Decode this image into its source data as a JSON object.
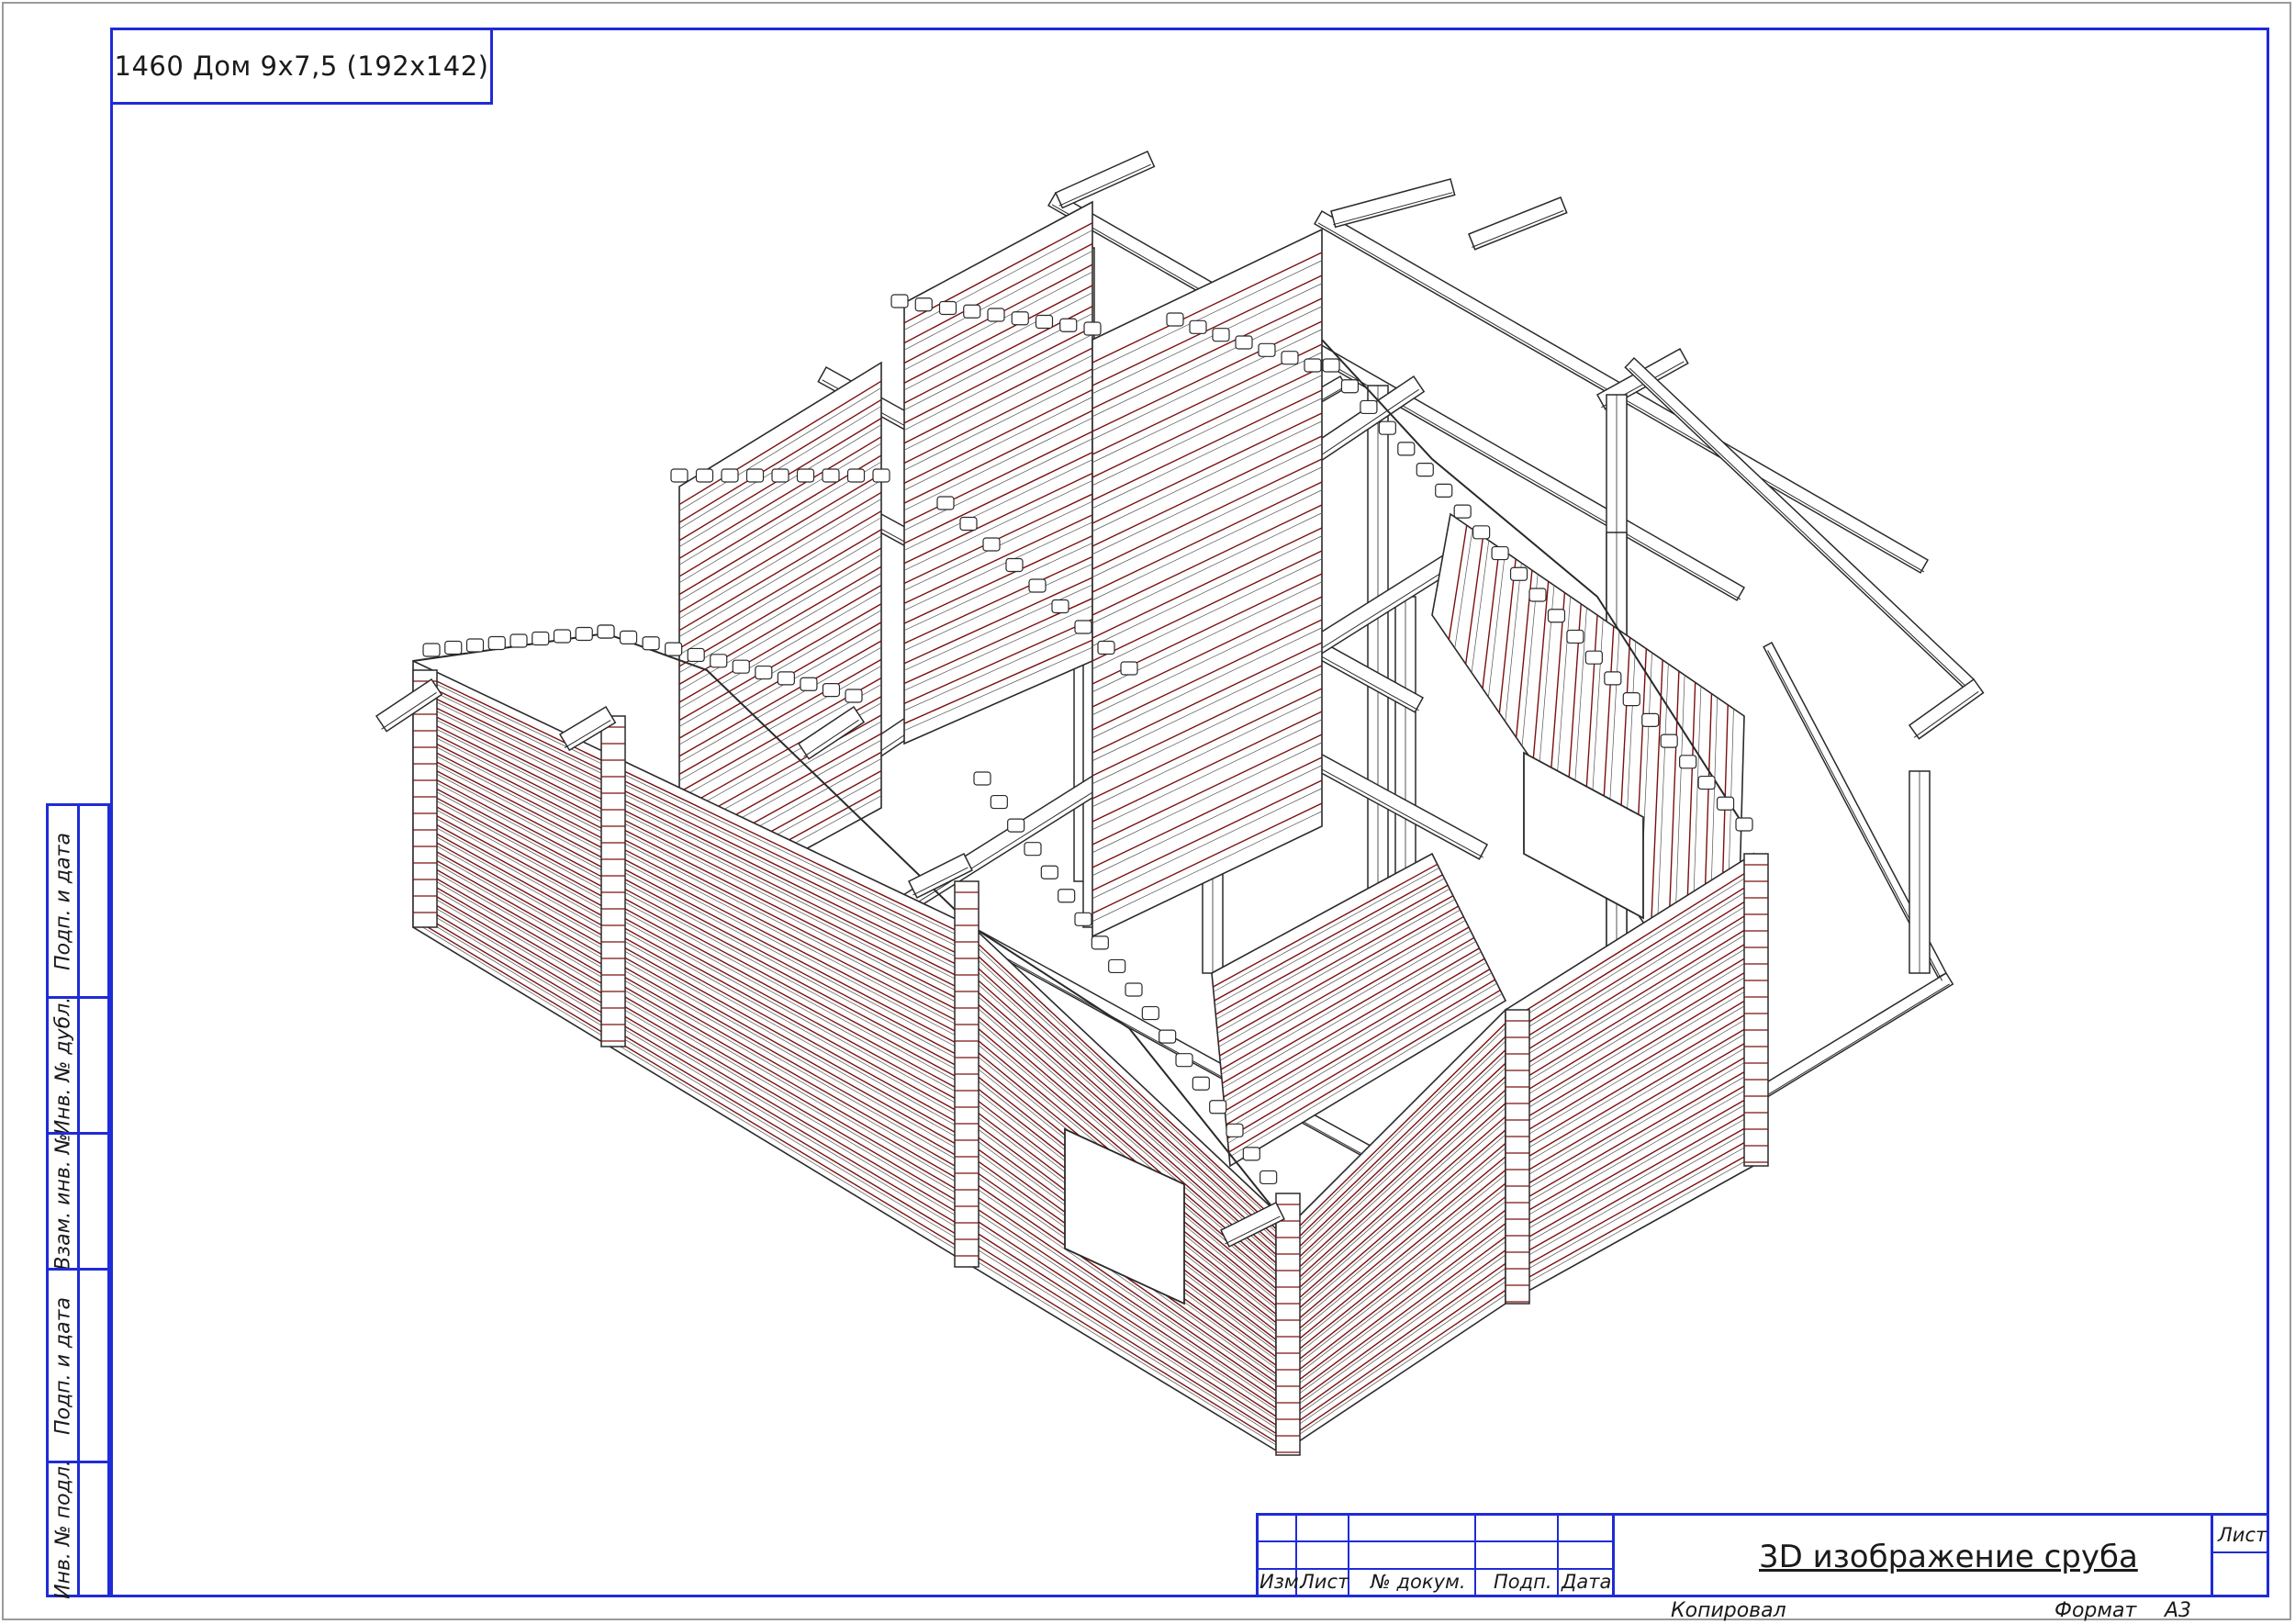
{
  "stamp": {
    "title": "1460 Дом 9x7,5 (192x142)"
  },
  "side_stamp": [
    {
      "label": "Подп. и дата"
    },
    {
      "label": "Инв. № дубл."
    },
    {
      "label": "Взам. инв. №"
    },
    {
      "label": "Подп. и дата"
    },
    {
      "label": "Инв. № подл."
    }
  ],
  "title_block": {
    "columns": [
      "Изм.",
      "Лист",
      "№ докум.",
      "Подп.",
      "Дата"
    ],
    "sheet_title": "3D изображение сруба",
    "sheet_label": "Лист"
  },
  "footer": {
    "copied": "Копировал",
    "format_label": "Формат",
    "format_value": "A3"
  },
  "colors": {
    "frame": "#1f2bd6",
    "log_line": "#7a1010",
    "outline": "#2a2a2a"
  }
}
